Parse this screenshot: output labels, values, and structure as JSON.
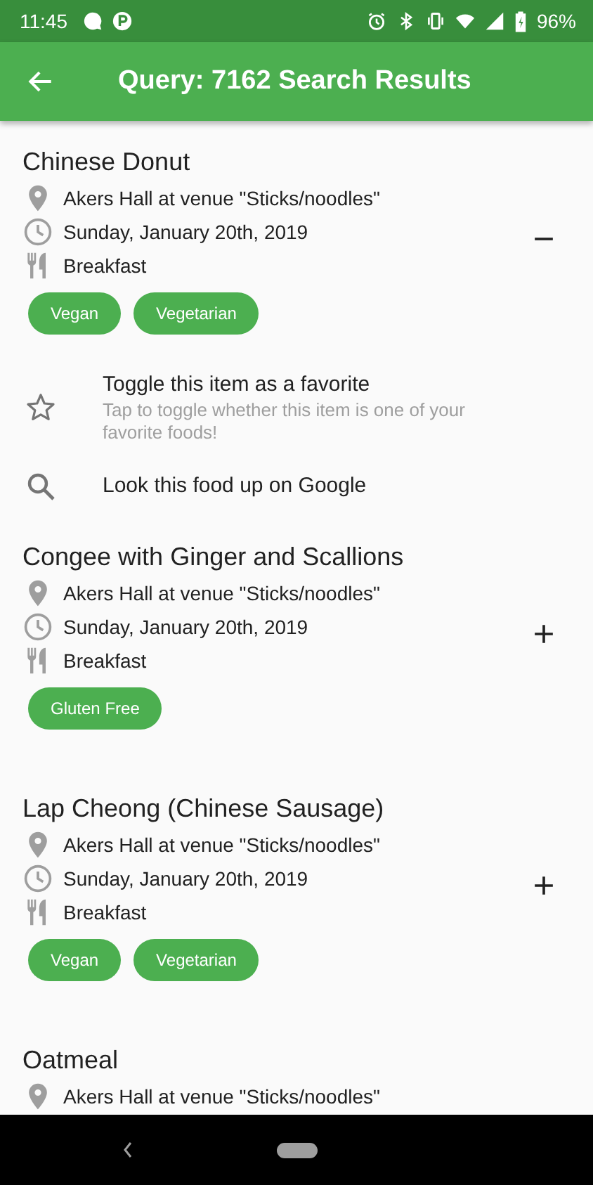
{
  "status_bar": {
    "time": "11:45",
    "battery": "96%"
  },
  "app_bar": {
    "title": "Query: 7162 Search Results"
  },
  "results": [
    {
      "name": "Chinese Donut",
      "location": "Akers Hall at venue \"Sticks/noodles\"",
      "date": "Sunday, January 20th, 2019",
      "meal": "Breakfast",
      "tags": [
        "Vegan",
        "Vegetarian"
      ],
      "expanded": true,
      "actions": [
        {
          "kind": "favorite",
          "title": "Toggle this item as a favorite",
          "subtitle": "Tap to toggle whether this item is one of your favorite foods!"
        },
        {
          "kind": "search",
          "title": "Look this food up on Google"
        }
      ]
    },
    {
      "name": "Congee with Ginger and Scallions",
      "location": "Akers Hall at venue \"Sticks/noodles\"",
      "date": "Sunday, January 20th, 2019",
      "meal": "Breakfast",
      "tags": [
        "Gluten Free"
      ],
      "expanded": false
    },
    {
      "name": "Lap Cheong (Chinese Sausage)",
      "location": "Akers Hall at venue \"Sticks/noodles\"",
      "date": "Sunday, January 20th, 2019",
      "meal": "Breakfast",
      "tags": [
        "Vegan",
        "Vegetarian"
      ],
      "expanded": false
    },
    {
      "name": "Oatmeal",
      "location": "Akers Hall at venue \"Sticks/noodles\""
    }
  ]
}
